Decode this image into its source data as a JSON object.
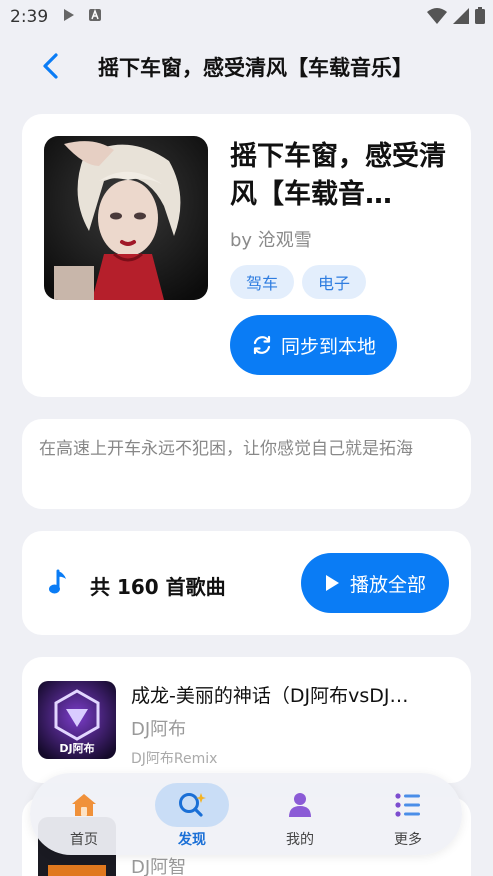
{
  "status_bar": {
    "time": "2:39"
  },
  "header": {
    "title": "摇下车窗，感受清风【车载音乐】"
  },
  "album": {
    "title": "摇下车窗，感受清风【车载音…",
    "author": "by 沧观雪",
    "tags": [
      "驾车",
      "电子"
    ],
    "sync_label": "同步到本地",
    "description": "在高速上开车永远不犯困，让你感觉自己就是拓海"
  },
  "playlist": {
    "count_text": "共 160 首歌曲",
    "play_all_label": "播放全部"
  },
  "songs": [
    {
      "title": "成龙-美丽的神话（DJ阿布vsDJ…",
      "artist": "DJ阿布",
      "album": "DJ阿布Remix",
      "cover_text": "DJ阿布"
    },
    {
      "title": "",
      "artist": "DJ阿智",
      "album": ""
    }
  ],
  "nav": {
    "items": [
      {
        "label": "首页",
        "icon": "home-icon"
      },
      {
        "label": "发现",
        "icon": "discover-icon",
        "active": true
      },
      {
        "label": "我的",
        "icon": "profile-icon"
      },
      {
        "label": "更多",
        "icon": "more-icon"
      }
    ]
  },
  "colors": {
    "accent": "#0a7cf5",
    "tag_bg": "#e3eefc",
    "background": "#eff0f5"
  }
}
